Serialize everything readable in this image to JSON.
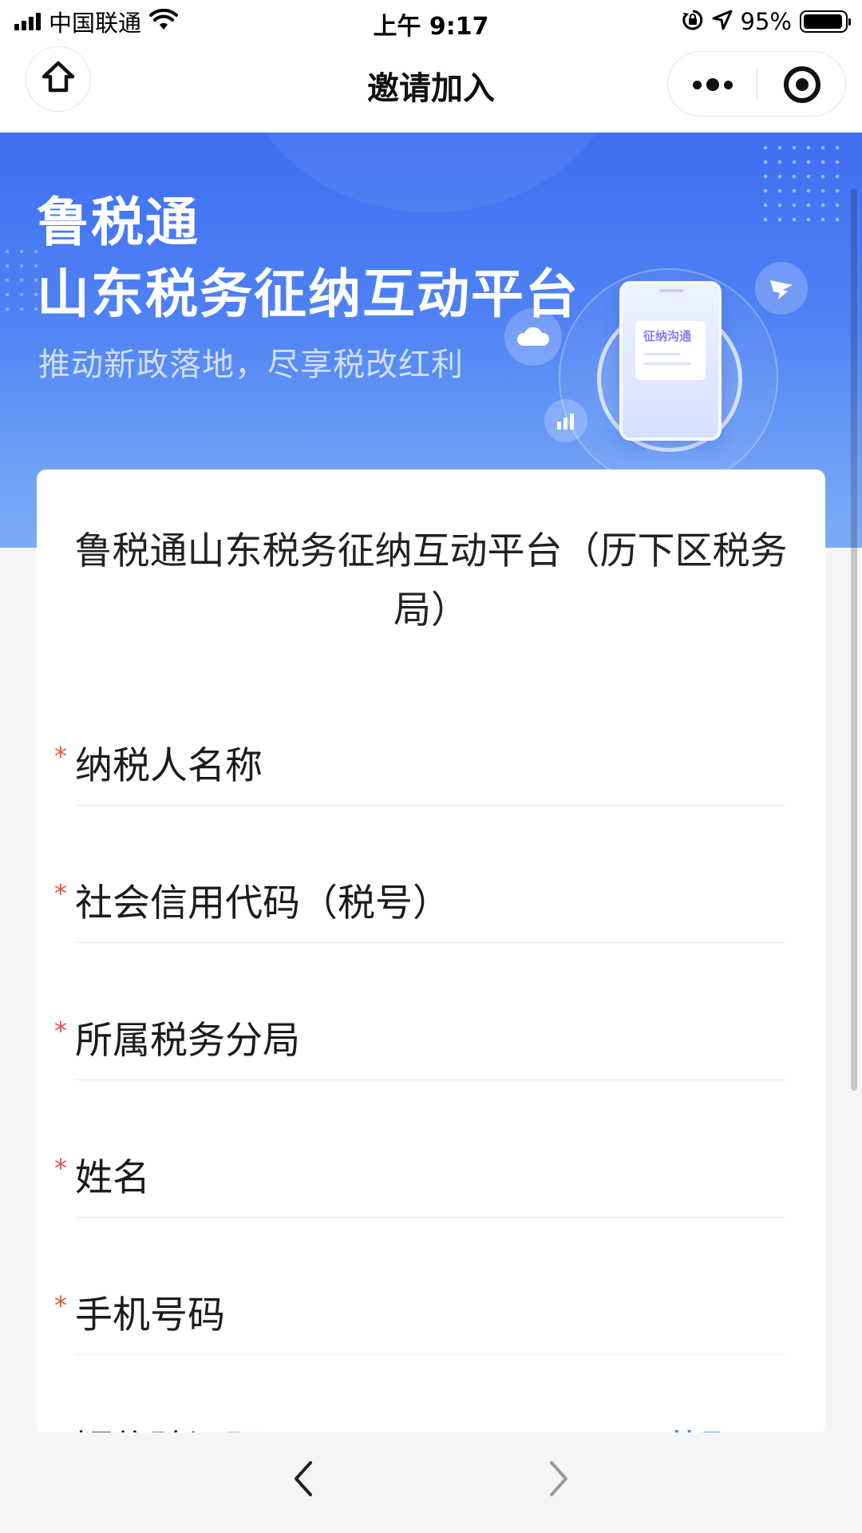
{
  "status_bar": {
    "carrier": "中国联通",
    "time": "上午 9:17",
    "battery": "95%",
    "battery_level": 0.95
  },
  "nav": {
    "title": "邀请加入"
  },
  "banner": {
    "title_line1": "鲁税通",
    "title_line2": "山东税务征纳互动平台",
    "subtitle": "推动新政落地，尽享税改红利",
    "phone_card_label": "征纳沟通"
  },
  "form": {
    "title": "鲁税通山东税务征纳互动平台（历下区税务局）",
    "required_mark": "*",
    "fields": [
      {
        "label": "纳税人名称"
      },
      {
        "label": "社会信用代码（税号）"
      },
      {
        "label": "所属税务分局"
      },
      {
        "label": "姓名"
      },
      {
        "label": "手机号码"
      },
      {
        "label": "短信验证码"
      }
    ],
    "get_code_label": "获取"
  },
  "colors": {
    "banner_top": "#3f6ff2",
    "banner_bottom": "#7cacf7",
    "required": "#e8543f",
    "link": "#3a78f2",
    "page_bg": "#f4f5f7"
  },
  "icons": {
    "home": "home-icon",
    "more": "more-dots-icon",
    "close": "mini-program-close-icon",
    "back": "chevron-left-icon",
    "forward": "chevron-right-icon"
  }
}
